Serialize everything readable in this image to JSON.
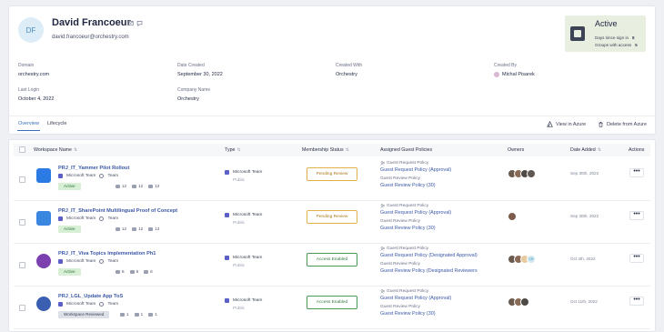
{
  "user": {
    "initials": "DF",
    "name": "David Francoeur",
    "email": "david.francoeur@orchestry.com"
  },
  "status": {
    "title": "Active",
    "days_label": "Days since sign in",
    "days_value": "8",
    "groups_label": "Groups with access",
    "groups_value": "5"
  },
  "fields": [
    {
      "label": "Domain",
      "value": "orchestry.com"
    },
    {
      "label": "Date Created",
      "value": "September 30, 2022"
    },
    {
      "label": "Created With",
      "value": "Orchestry"
    },
    {
      "label": "Created By",
      "value": "Michal Pisarek"
    },
    {
      "label": "Last Login",
      "value": "October 4, 2022"
    },
    {
      "label": "Company Name",
      "value": "Orchestry"
    }
  ],
  "tabs": [
    "Overview",
    "Lifecycle"
  ],
  "actions": {
    "view_azure": "View in Azure",
    "delete_azure": "Delete from Azure"
  },
  "columns": [
    "Workspace Name",
    "Type",
    "Membership Status",
    "Assigned Guest Policies",
    "Owners",
    "Date Added",
    "Actions"
  ],
  "rows": [
    {
      "name": "PRJ_IT_Yammer Pilot Rollout",
      "kind": "Microsoft Team",
      "vis": "Team",
      "badge": "Active",
      "counts": [
        "12",
        "12",
        "12"
      ],
      "type": "Microsoft Team",
      "privacy": "Public",
      "membership": "Pending Review",
      "policy_label1": "Guest Request Policy",
      "policy1": "Guest Request Policy (Approval)",
      "policy_label2": "Guest Review Policy",
      "policy2": "Guest Review Policy (30)",
      "date": "Sep 30th, 2022",
      "actions": "•••"
    },
    {
      "name": "PRJ_IT_SharePoint Multilingual Proof of Concept",
      "kind": "Microsoft Team",
      "vis": "Team",
      "badge": "Active",
      "counts": [
        "12",
        "12",
        "12"
      ],
      "type": "Microsoft Team",
      "privacy": "Public",
      "membership": "Pending Review",
      "policy_label1": "Guest Request Policy",
      "policy1": "Guest Request Policy (Approval)",
      "policy_label2": "Guest Review Policy",
      "policy2": "Guest Review Policy (30)",
      "date": "Sep 30th, 2022",
      "actions": "•••"
    },
    {
      "name": "PRJ_IT_Viva Topics Implementation Ph1",
      "kind": "Microsoft Team",
      "vis": "Team",
      "badge": "Active",
      "counts": [
        "8",
        "6",
        "6"
      ],
      "type": "Microsoft Team",
      "privacy": "Public",
      "membership": "Access Enabled",
      "policy_label1": "Guest Request Policy",
      "policy1": "Guest Request Policy (Designated Approval)",
      "policy_label2": "Guest Review Policy",
      "policy2": "Guest Review Policy (Designated Reviewers",
      "date": "Oct 4th, 2022",
      "owner_initials": "CR",
      "actions": "•••"
    },
    {
      "name": "PRJ_LGL_Update App ToS",
      "kind": "Microsoft Team",
      "vis": "Team",
      "badge": "Workspace Reviewed",
      "counts": [
        "1",
        "1",
        "1"
      ],
      "type": "Microsoft Team",
      "privacy": "Public",
      "membership": "Access Enabled",
      "policy_label1": "Guest Request Policy",
      "policy1": "Guest Request Policy (Approval)",
      "policy_label2": "Guest Review Policy",
      "policy2": "Guest Review Policy (30)",
      "date": "Oct 11th, 2022",
      "actions": "•••"
    }
  ],
  "colors": {
    "accent": "#3a6fb5",
    "pending": "#e2b24a",
    "enabled": "#4a9a56",
    "active_badge": "#d7f0d5"
  }
}
